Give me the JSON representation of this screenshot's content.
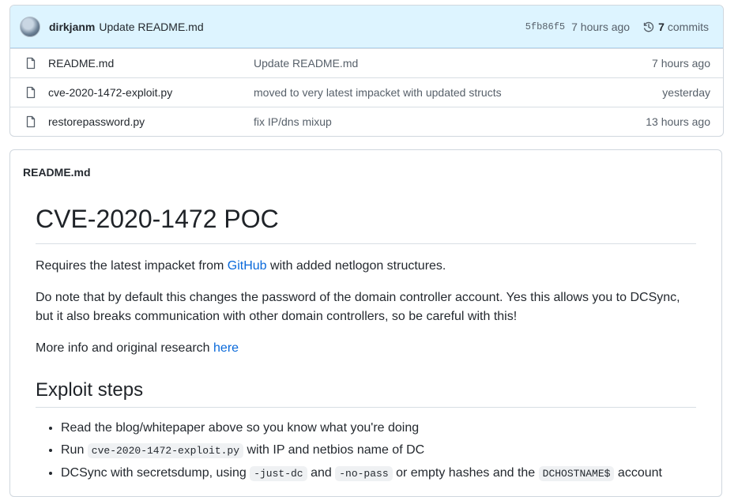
{
  "latest_commit": {
    "author": "dirkjanm",
    "message": "Update README.md",
    "sha": "5fb86f5",
    "time": "7 hours ago",
    "commit_count": "7",
    "commits_label": "commits"
  },
  "files": [
    {
      "name": "README.md",
      "message": "Update README.md",
      "time": "7 hours ago"
    },
    {
      "name": "cve-2020-1472-exploit.py",
      "message": "moved to very latest impacket with updated structs",
      "time": "yesterday"
    },
    {
      "name": "restorepassword.py",
      "message": "fix IP/dns mixup",
      "time": "13 hours ago"
    }
  ],
  "readme": {
    "filename": "README.md",
    "title": "CVE-2020-1472 POC",
    "p1_pre": "Requires the latest impacket from ",
    "p1_link": "GitHub",
    "p1_post": " with added netlogon structures.",
    "p2": "Do note that by default this changes the password of the domain controller account. Yes this allows you to DCSync, but it also breaks communication with other domain controllers, so be careful with this!",
    "p3_pre": "More info and original research ",
    "p3_link": "here",
    "h2": "Exploit steps",
    "steps": {
      "s1": "Read the blog/whitepaper above so you know what you're doing",
      "s2_a": "Run ",
      "s2_code": "cve-2020-1472-exploit.py",
      "s2_b": " with IP and netbios name of DC",
      "s3_a": "DCSync with secretsdump, using ",
      "s3_code1": "-just-dc",
      "s3_b": " and ",
      "s3_code2": "-no-pass",
      "s3_c": " or empty hashes and the ",
      "s3_code3": "DCHOSTNAME$",
      "s3_d": " account"
    }
  },
  "icons": {
    "file": "file-icon",
    "history": "history-icon",
    "avatar": "avatar"
  }
}
